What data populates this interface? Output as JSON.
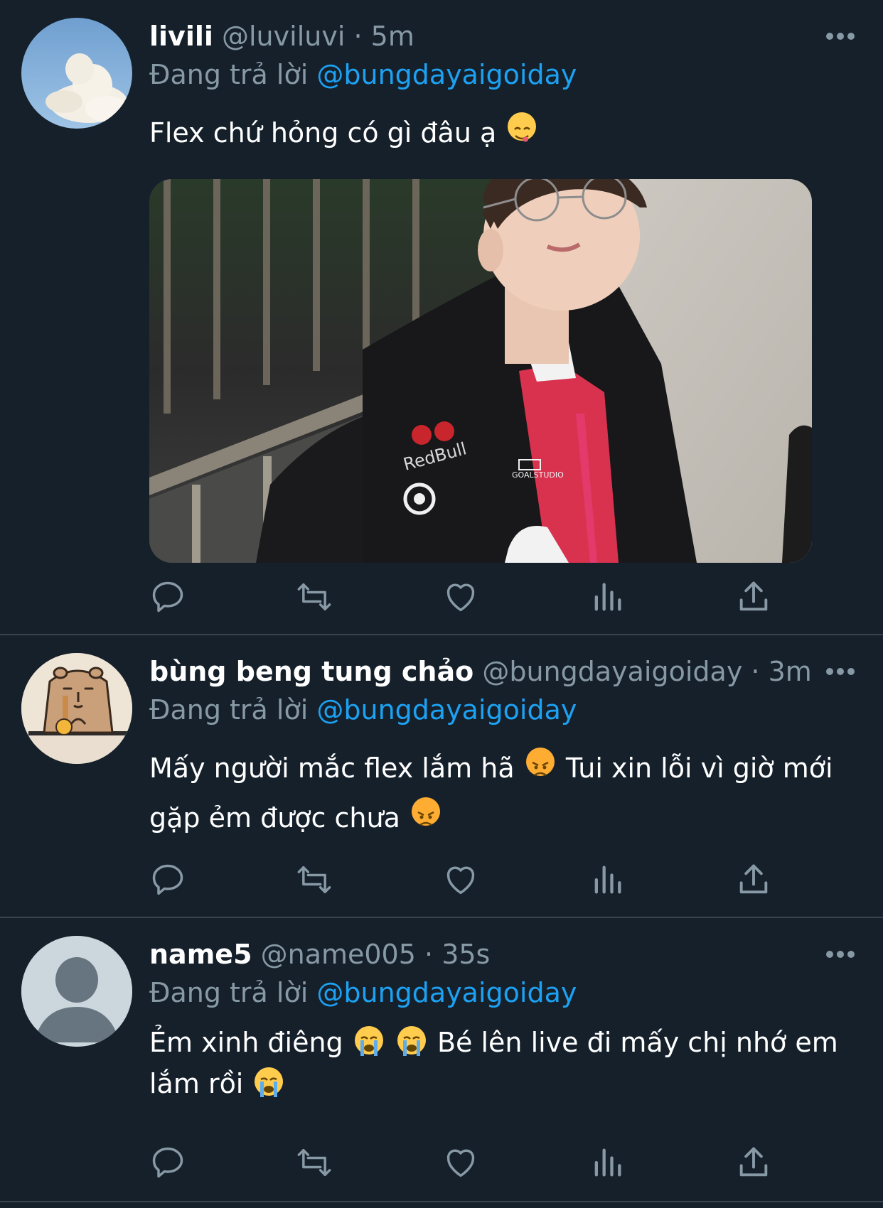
{
  "tweets": [
    {
      "display_name": "livili",
      "handle": "@luviluvi",
      "separator": "·",
      "time": "5m",
      "reply_prefix": "Đang trả lời",
      "reply_mention": "@bungdayaigoiday",
      "text_parts": [
        "Flex chứ hỏng có gì đâu ạ"
      ],
      "emojis": [
        "yum-emoji"
      ]
    },
    {
      "display_name": "bùng beng tung chảo",
      "handle": "@bungdayaigoiday",
      "separator": "·",
      "time": "3m",
      "reply_prefix": "Đang trả lời",
      "reply_mention": "@bungdayaigoiday",
      "text_parts": [
        "Mấy người mắc flex lắm hã",
        "Tui xin lỗi vì giờ mới",
        "gặp ẻm được chưa"
      ],
      "emojis": [
        "angry-emoji",
        "angry-emoji"
      ]
    },
    {
      "display_name": "name5",
      "handle": "@name005",
      "separator": "·",
      "time": "35s",
      "reply_prefix": "Đang trả lời",
      "reply_mention": "@bungdayaigoiday",
      "text_parts": [
        "Ẻm xinh điêng",
        "Bé lên live đi mấy chị nhớ em",
        "lắm rồi"
      ],
      "emojis": [
        "crying-emoji",
        "crying-emoji",
        "crying-emoji"
      ]
    }
  ],
  "media": {
    "jacket_logos": [
      "RedBull",
      "GOALSTUDIO"
    ]
  },
  "colors": {
    "background": "#15202b",
    "divider": "#38444d",
    "secondary_text": "#8899a6",
    "mention": "#1da1f2"
  },
  "icons": [
    "reply-icon",
    "retweet-icon",
    "like-icon",
    "analytics-icon",
    "share-icon",
    "more-icon"
  ]
}
